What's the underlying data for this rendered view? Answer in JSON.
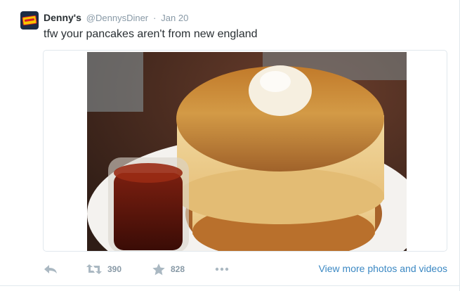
{
  "tweet": {
    "name": "Denny's",
    "handle": "@DennysDiner",
    "separator": "·",
    "time": "Jan 20",
    "text": "tfw your pancakes aren't from new england",
    "avatar_icon": "dennys-logo-icon",
    "photo_description_icon": "pancake-stack-photo"
  },
  "actions": {
    "reply_icon": "reply-arrow-icon",
    "retweet_icon": "retweet-icon",
    "retweet_count": "390",
    "favorite_icon": "star-icon",
    "favorite_count": "828",
    "more_icon": "ellipsis-icon",
    "view_more_label": "View more photos and videos"
  },
  "colors": {
    "name": "#292f33",
    "meta": "#8899a6",
    "action_icon": "#aab8c2",
    "link": "#3b88c3",
    "border": "#e1e8ed"
  }
}
